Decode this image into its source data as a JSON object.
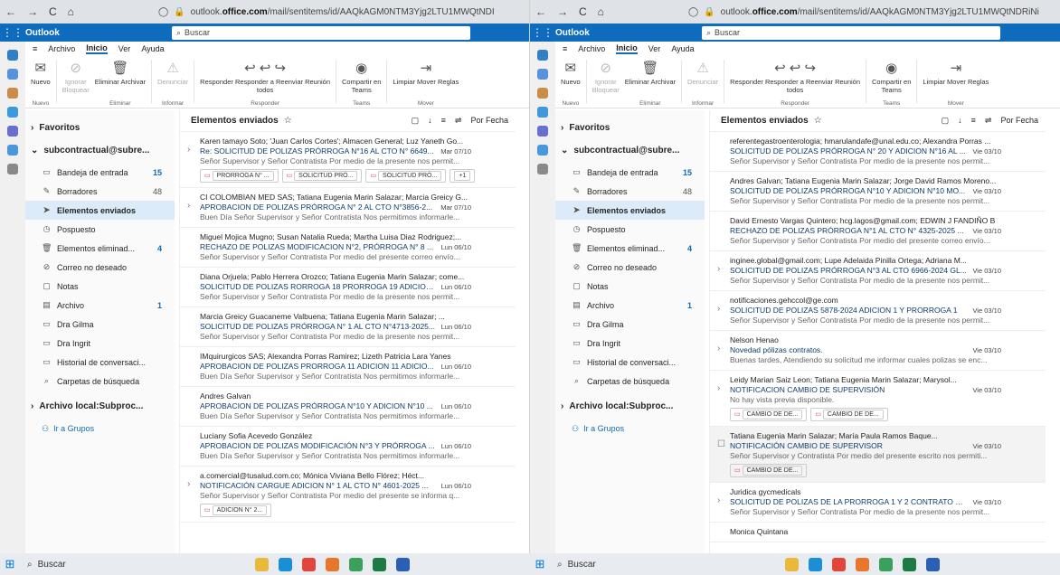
{
  "left": {
    "url_prefix": "outlook.",
    "url_domain": "office.com",
    "url_rest": "/mail/sentitems/id/AAQkAGM0NTM3Yjg2LTU1MWQtNDI",
    "search_placeholder": "Buscar",
    "app_name": "Outlook",
    "tabs": [
      "Archivo",
      "Inicio",
      "Ver",
      "Ayuda"
    ],
    "folders_title": "Favoritos",
    "account": "subcontractual@subre...",
    "list_title": "Elementos enviados",
    "sort": "Por Fecha",
    "messages": [
      {
        "from": "Karen tamayo Soto; 'Juan Carlos Cortes'; Almacen General; Luz Yaneth Go...",
        "subj": "Re: SOLICITUD DE POLIZAS PRÓRROGA N°16 AL CTO N° 6649...",
        "date": "Mar 07/10",
        "prev": "Señor Supervisor y Señor Contratista Por medio de la presente nos permit...",
        "att": [
          "PRORROGA N° ...",
          "SOLICITUD PRÓ...",
          "SOLICITUD PRÓ...",
          "+1"
        ],
        "chev": true
      },
      {
        "from": "CI COLOMBIAN MED SAS; Tatiana Eugenia Marin Salazar; Marcia Greicy G...",
        "subj": "APROBACION DE POLIZAS PRÓRROGA N° 2 AL CTO N°3856-2...",
        "date": "Mar 07/10",
        "prev": "Buen Día Señor Supervisor y Señor Contratista Nos permitimos informarle...",
        "chev": true
      },
      {
        "from": "Miguel Mojica Mugno; Susan Natalia Rueda; Martha Luisa Diaz Rodriguez;...",
        "subj": "RECHAZO DE POLIZAS MODIFICACION N°2, PRÓRROGA N° 8 ...",
        "date": "Lun 06/10",
        "prev": "Señor Supervisor y Señor Contratista Por medio del presente correo envío..."
      },
      {
        "from": "Diana Orjuela; Pablo Herrera Orozco; Tatiana Eugenia Marin Salazar; come...",
        "subj": "SOLICITUD DE POLIZAS RORROGA 18 PRORROGA 19 ADICION...",
        "date": "Lun 06/10",
        "prev": "Señor Supervisor y Señor Contratista Por medio de la presente nos permit..."
      },
      {
        "from": "Marcia Greicy Guacaneme Valbuena; Tatiana Eugenia Marin Salazar; ...",
        "subj": "SOLICITUD DE POLIZAS PRÓRROGA N° 1 AL CTO N°4713-2025...",
        "date": "Lun 06/10",
        "prev": "Señor Supervisor y Señor Contratista Por medio de la presente nos permit..."
      },
      {
        "from": "IMquirurgicos SAS; Alexandra Porras Ramirez; Lizeth Patricia Lara Yanes",
        "subj": "APROBACION DE POLIZAS PRORROGA 11 ADICION 11 ADICIO...",
        "date": "Lun 06/10",
        "prev": "Buen Día Señor Supervisor y Señor Contratista Nos permitimos informarle..."
      },
      {
        "from": "Andres Galvan",
        "subj": "APROBACION DE POLIZAS PRÓRROGA N°10 Y ADICION N°10 ...",
        "date": "Lun 06/10",
        "prev": "Buen Día Señor Supervisor y Señor Contratista Nos permitimos informarle..."
      },
      {
        "from": "Luciany Sofia Acevedo González",
        "subj": "APROBACION DE POLIZAS MODIFICACIÓN N°3 Y PRÓRROGA ...",
        "date": "Lun 06/10",
        "prev": "Buen Día Señor Supervisor y Señor Contratista Nos permitimos informarle..."
      },
      {
        "from": "a.comercial@tusalud.com.co; Mónica Viviana Bello Flórez; Héct...",
        "subj": "NOTIFICACIÓN CARGUE ADICION N° 1 AL CTO N° 4601-2025 ...",
        "date": "Lun 06/10",
        "prev": "Señor Supervisor y Señor Contratista Por medio del presente se informa q...",
        "att": [
          "ADICION N° 2..."
        ],
        "chev": true
      }
    ]
  },
  "right": {
    "url_prefix": "outlook.",
    "url_domain": "office.com",
    "url_rest": "/mail/sentitems/id/AAQkAGM0NTM3Yjg2LTU1MWQtNDRiNi",
    "search_placeholder": "Buscar",
    "app_name": "Outlook",
    "tabs": [
      "Archivo",
      "Inicio",
      "Ver",
      "Ayuda"
    ],
    "folders_title": "Favoritos",
    "account": "subcontractual@subre...",
    "list_title": "Elementos enviados",
    "sort": "Por Fecha",
    "messages": [
      {
        "from": "referentegastroenterologia; hmarulandafe@unal.edu.co; Alexandra Porras ...",
        "subj": "SOLICITUD DE POLIZAS PRÓRROGA N° 20 Y ADICION N°16 AL ...",
        "date": "Vie 03/10",
        "prev": "Señor Supervisor y Señor Contratista Por medio de la presente nos permit..."
      },
      {
        "from": "Andres Galvan; Tatiana Eugenia Marin Salazar; Jorge David Ramos Moreno...",
        "subj": "SOLICITUD DE POLIZAS PRÓRROGA N°10 Y ADICION N°10 MO...",
        "date": "Vie 03/10",
        "prev": "Señor Supervisor y Señor Contratista Por medio de la presente nos permit..."
      },
      {
        "from": "David Ernesto Vargas Quintero; hcg.lagos@gmail.com; EDWIN J FANDIÑO B",
        "subj": "RECHAZO DE POLIZAS PRÓRROGA N°1 AL CTO N° 4325-2025 ... ",
        "date": "Vie 03/10",
        "prev": "Señor Supervisor y Señor Contratista Por medio del presente correo envío..."
      },
      {
        "from": "inginee.global@gmail.com; Lupe Adelaida Pinilla Ortega; Adriana M...",
        "subj": "SOLICITUD DE POLIZAS PRÓRROGA N°3 AL CTO 6966-2024 GL...",
        "date": "Vie 03/10",
        "prev": "Señor Supervisor y Señor Contratista Por medio de la presente nos permit...",
        "chev": true
      },
      {
        "from": "notificaciones.gehccol@ge.com",
        "subj": "SOLICITUD DE POLIZAS 5878-2024 ADICION 1 Y PRORROGA 1",
        "date": "Vie 03/10",
        "prev": "Señor Supervisor y Señor Contratista Por medio de la presente nos permit...",
        "chev": true
      },
      {
        "from": "Nelson Henao",
        "subj": "Novedad pólizas contratos.",
        "date": "Vie 03/10",
        "prev": "Buenas tardes, Atendiendo su solicitud me informar cuales polizas se enc...",
        "chev": true
      },
      {
        "from": "Leidy Marian Saiz Leon; Tatiana Eugenia Marin Salazar; Marysol...",
        "subj": "NOTIFICACION CAMBIO DE SUPERVISIÓN",
        "date": "Vie 03/10",
        "prev": "No hay vista previa disponible.",
        "att": [
          "CAMBIO DE DE...",
          "CAMBIO DE DE..."
        ],
        "chev": true
      },
      {
        "from": "Tatiana Eugenia Marin Salazar; María Paula Ramos Baque...",
        "subj": "NOTIFICACIÓN CAMBIO DE SUPERVISOR",
        "date": "Vie 03/10",
        "prev": "Señor Supervisor y Contratista Por medio del presente escrito nos permiti...",
        "att": [
          "CAMBIO DE DE..."
        ],
        "sel": true
      },
      {
        "from": "Juridica gycmedicals",
        "subj": "SOLICITUD DE POLIZAS DE LA PRORROGA 1 Y 2 CONTRATO 54...",
        "date": "Vie 03/10",
        "prev": "Señor Supervisor y Señor Contratista Por medio de la presente nos permit...",
        "chev": true
      },
      {
        "from": "Monica Quintana",
        "subj": "",
        "date": "",
        "prev": ""
      }
    ]
  },
  "folders": [
    {
      "name": "Bandeja de entrada",
      "count": "15",
      "icon": "inbox-icon",
      "glyph": "▭"
    },
    {
      "name": "Borradores",
      "count": "48",
      "icon": "draft-icon",
      "glyph": "✎",
      "gray": true
    },
    {
      "name": "Elementos enviados",
      "count": "",
      "icon": "send-icon",
      "glyph": "➤",
      "sel": true
    },
    {
      "name": "Pospuesto",
      "count": "",
      "icon": "clock-icon",
      "glyph": "◷"
    },
    {
      "name": "Elementos eliminad...",
      "count": "4",
      "icon": "trash-icon",
      "glyph": "🗑"
    },
    {
      "name": "Correo no deseado",
      "count": "",
      "icon": "junk-icon",
      "glyph": "⊘"
    },
    {
      "name": "Notas",
      "count": "",
      "icon": "note-icon",
      "glyph": "▢"
    },
    {
      "name": "Archivo",
      "count": "1",
      "icon": "archive-icon",
      "glyph": "▤"
    },
    {
      "name": "Dra Gilma",
      "count": "",
      "icon": "folder-icon",
      "glyph": "▭"
    },
    {
      "name": "Dra Ingrit",
      "count": "",
      "icon": "folder-icon",
      "glyph": "▭"
    },
    {
      "name": "Historial de conversaci...",
      "count": "",
      "icon": "folder-icon",
      "glyph": "▭"
    },
    {
      "name": "Carpetas de búsqueda",
      "count": "",
      "icon": "search-folder-icon",
      "glyph": "⌕"
    }
  ],
  "local_archive": "Archivo local:Subproc...",
  "groups_link": "Ir a Grupos",
  "ribbon": [
    {
      "lbl": "Nuevo",
      "grp": "Nuevo",
      "ic": "✉",
      "name": "new-mail"
    },
    {
      "lbl": "Ignorar\nBloquear",
      "ic": "⊘",
      "dim": true,
      "name": "ignore"
    },
    {
      "lbl": "Eliminar Archivar",
      "ic": "🗑",
      "grp": "Eliminar",
      "name": "delete"
    },
    {
      "lbl": "Denunciar",
      "ic": "⚠",
      "grp": "Informar",
      "dim": true,
      "name": "report"
    },
    {
      "lbl": "Responder Responder a Reenviar Reunión\ntodos",
      "ic": "↩ ↩ ↪",
      "grp": "Responder",
      "name": "reply"
    },
    {
      "lbl": "Compartir en\nTeams",
      "ic": "◉",
      "grp": "Teams",
      "name": "teams"
    },
    {
      "lbl": "Limpiar Mover Reglas",
      "ic": "⇥",
      "grp": "Mover",
      "name": "move"
    }
  ],
  "taskbar_search": "Buscar"
}
